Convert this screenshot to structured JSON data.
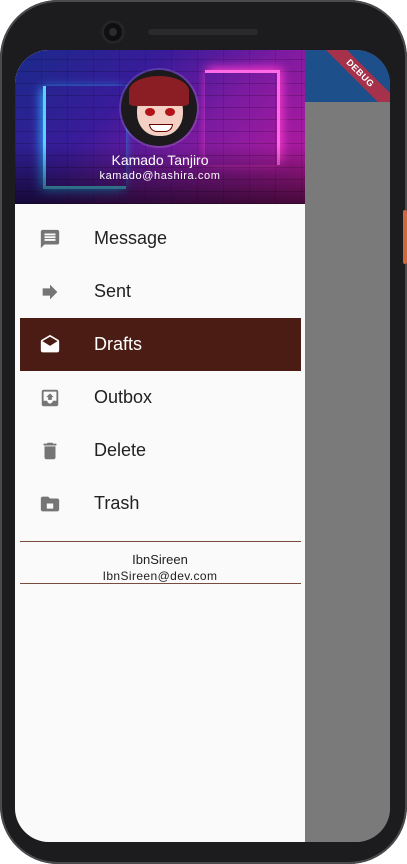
{
  "debug_banner": "DEBUG",
  "drawer": {
    "header": {
      "account_name": "Kamado Tanjiro",
      "account_email": "kamado@hashira.com"
    },
    "items": [
      {
        "label": "Message",
        "icon": "message-icon",
        "active": false
      },
      {
        "label": "Sent",
        "icon": "arrow-forward-icon",
        "active": false
      },
      {
        "label": "Drafts",
        "icon": "open-envelope-icon",
        "active": true
      },
      {
        "label": "Outbox",
        "icon": "outbox-icon",
        "active": false
      },
      {
        "label": "Delete",
        "icon": "trash-can-icon",
        "active": false
      },
      {
        "label": "Trash",
        "icon": "trash-folder-icon",
        "active": false
      }
    ],
    "footer": {
      "name": "IbnSireen",
      "email": "IbnSireen@dev.com"
    }
  },
  "colors": {
    "app_bar": "#1d4f8a",
    "active_item": "#4b1c14",
    "divider": "#7b4a3e",
    "scrim": "#7a7a7a",
    "icon": "#757575"
  }
}
